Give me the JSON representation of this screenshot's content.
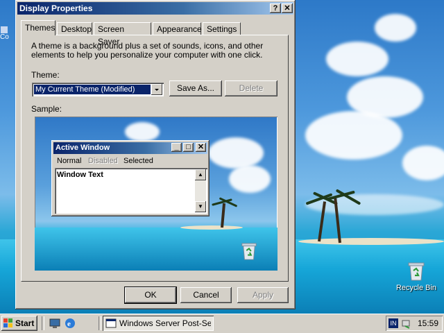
{
  "dialog": {
    "title": "Display Properties",
    "help_glyph": "?",
    "close_glyph": "✕",
    "tabs": [
      "Themes",
      "Desktop",
      "Screen Saver",
      "Appearance",
      "Settings"
    ],
    "active_tab": "Themes",
    "description": "A theme is a background plus a set of sounds, icons, and other elements to help you personalize your computer with one click.",
    "theme_label": "Theme:",
    "theme_value": "My Current Theme (Modified)",
    "save_as_label": "Save As...",
    "delete_label": "Delete",
    "sample_label": "Sample:",
    "sample": {
      "window_title": "Active Window",
      "menu": [
        "Normal",
        "Disabled",
        "Selected"
      ],
      "window_text": "Window Text"
    },
    "ok_label": "OK",
    "cancel_label": "Cancel",
    "apply_label": "Apply"
  },
  "desktop": {
    "recycle_bin_label": "Recycle Bin",
    "partial_icon_label": "Co"
  },
  "taskbar": {
    "start_label": "Start",
    "task_label": "Windows Server Post-Se...",
    "lang": "IN",
    "clock": "15:59"
  },
  "icons": [
    "windows-logo-icon",
    "desktop-icon",
    "ie-icon",
    "window-app-icon",
    "network-icon",
    "recycle-bin-icon"
  ]
}
